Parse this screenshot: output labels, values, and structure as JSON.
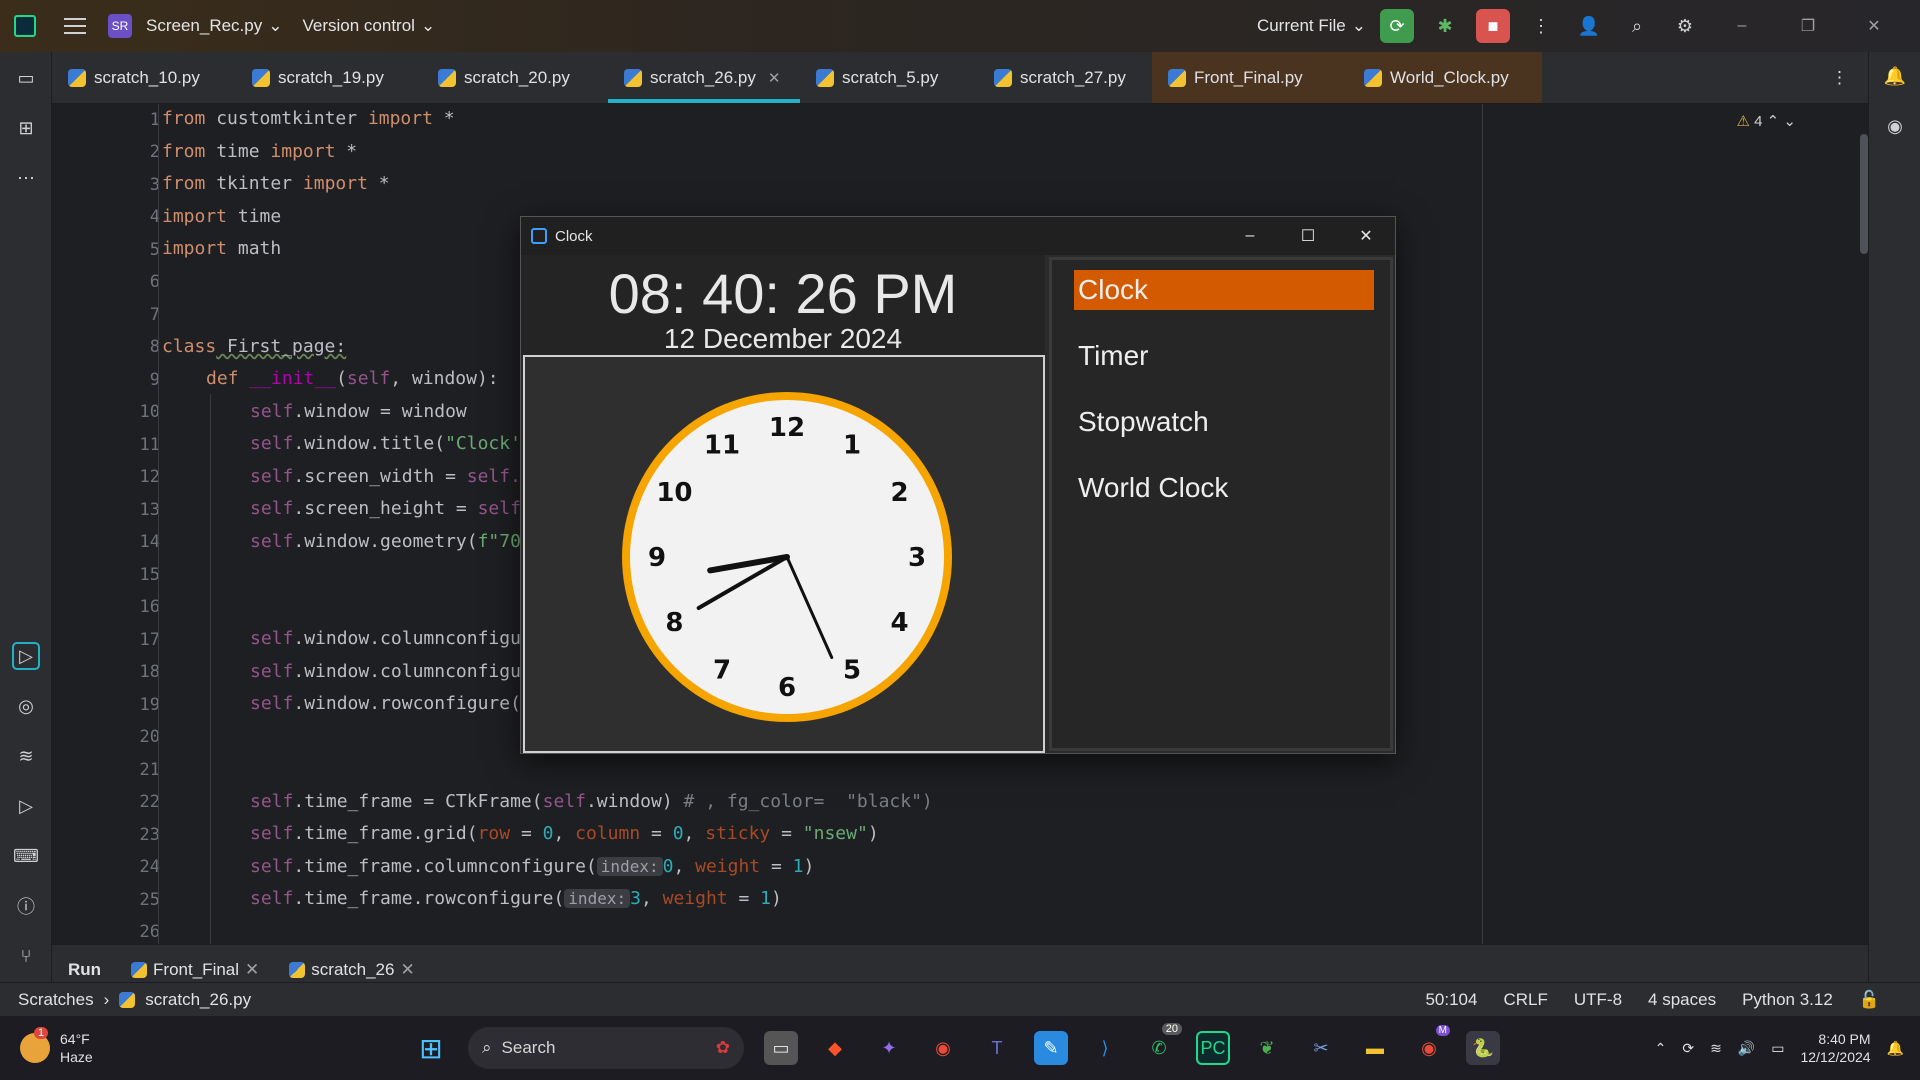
{
  "ide": {
    "project_badge": "SR",
    "project_name": "Screen_Rec.py",
    "vcs": "Version control",
    "run_config": "Current File",
    "warnings": "4"
  },
  "tabs": [
    {
      "label": "scratch_10.py"
    },
    {
      "label": "scratch_19.py"
    },
    {
      "label": "scratch_20.py"
    },
    {
      "label": "scratch_26.py"
    },
    {
      "label": "scratch_5.py"
    },
    {
      "label": "scratch_27.py"
    },
    {
      "label": "Front_Final.py"
    },
    {
      "label": "World_Clock.py"
    }
  ],
  "line_numbers": [
    "1",
    "2",
    "3",
    "4",
    "5",
    "6",
    "7",
    "8",
    "9",
    "10",
    "11",
    "12",
    "13",
    "14",
    "15",
    "16",
    "17",
    "18",
    "19",
    "20",
    "21",
    "22",
    "23",
    "24",
    "25",
    "26"
  ],
  "code": {
    "l1_kw": "from",
    "l1_mod": " customtkinter ",
    "l1_kw2": "import",
    "l1_rest": " *",
    "l2_kw": "from",
    "l2_mod": " time ",
    "l2_kw2": "import",
    "l2_rest": " *",
    "l3_kw": "from",
    "l3_mod": " tkinter ",
    "l3_kw2": "import",
    "l3_rest": " *",
    "l4_kw": "import",
    "l4_rest": " time",
    "l5_kw": "import",
    "l5_rest": " math",
    "l8_kw": "class",
    "l8_rest": " First_page:",
    "l9_kw": "def",
    "l9_fn": " __init__",
    "l9_a": "(",
    "l9_self": "self",
    "l9_b": ", window):",
    "l10": "self",
    "l10_rest": ".window = window",
    "l11": "self",
    "l11_rest": ".window.title(",
    "l11_str": "\"Clock'",
    "l12": "self",
    "l12_rest": ".screen_width = ",
    "l12_self": "self.",
    "l13": "self",
    "l13_rest": ".screen_height = ",
    "l13_self": "self",
    "l14": "self",
    "l14_rest": ".window.geometry(",
    "l14_str": "f\"70",
    "l17": "self",
    "l17_rest": ".window.columnconfigu",
    "l18": "self",
    "l18_rest": ".window.columnconfigu",
    "l19": "self",
    "l19_rest": ".window.rowconfigure(",
    "l22": "self",
    "l22_rest": ".time_frame = CTkFrame(",
    "l22_self": "self",
    ".l22_rest2": "",
    "l22_b": ".window) ",
    "l22_cmt": "# , fg_color=  \"black\")",
    "l23": "self",
    "l23_rest": ".time_frame.grid(",
    "l23_p1": "row",
    "l23_e1": " = ",
    "l23_n1": "0",
    ", ": "",
    "l23_c1": ", ",
    "l23_p2": "column",
    "l23_e2": " = ",
    "l23_n2": "0",
    "l23_c2": ", ",
    "l23_p3": "sticky",
    "l23_e3": " = ",
    "l23_s": "\"nsew\"",
    "l23_end": ")",
    "l24": "self",
    "l24_rest": ".time_frame.columnconfigure(",
    "l24_hint": "index:",
    "l24_n": "0",
    "l24_c": ", ",
    "l24_p": "weight",
    "l24_e": " = ",
    "l24_n2": "1",
    "l24_end": ")",
    "l25": "self",
    "l25_rest": ".time_frame.rowconfigure(",
    "l25_hint": "index:",
    "l25_n": "3",
    "l25_c": ", ",
    "l25_p": "weight",
    "l25_e": " = ",
    "l25_n2": "1",
    "l25_end": ")"
  },
  "run_panel": {
    "title": "Run",
    "tabs": [
      {
        "label": "Front_Final"
      },
      {
        "label": "scratch_26"
      }
    ]
  },
  "status": {
    "breadcrumb_root": "Scratches",
    "breadcrumb_file": "scratch_26.py",
    "position": "50:104",
    "line_sep": "CRLF",
    "encoding": "UTF-8",
    "indent": "4 spaces",
    "interpreter": "Python 3.12"
  },
  "clock_window": {
    "title": "Clock",
    "time": "08: 40: 26 PM",
    "date": "12 December 2024",
    "menu": [
      {
        "label": "Clock",
        "selected": true
      },
      {
        "label": "Timer"
      },
      {
        "label": "Stopwatch"
      },
      {
        "label": "World Clock"
      }
    ],
    "dial_numbers": [
      "12",
      "1",
      "2",
      "3",
      "4",
      "5",
      "6",
      "7",
      "8",
      "9",
      "10",
      "11"
    ],
    "hands": {
      "hour": 8.67,
      "minute": 40,
      "second": 26
    },
    "colors": {
      "rim": "#f5a400",
      "face": "#f2f2f2",
      "selected": "#d45a00"
    }
  },
  "taskbar": {
    "weather_temp": "64°F",
    "weather_desc": "Haze",
    "weather_badge": "1",
    "search": "Search",
    "whatsapp_badge": "20",
    "chrome_badge": "M",
    "time": "8:40 PM",
    "date": "12/12/2024"
  }
}
